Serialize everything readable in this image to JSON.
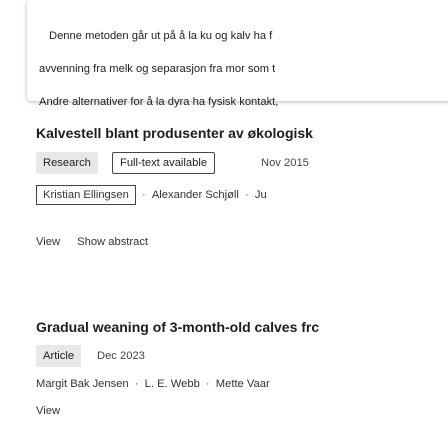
{
  "snippet": {
    "lines": [
      "Denne metoden går ut på å la ku og kalv ha f",
      "avvenning fra melk og separasjon fra mor som t",
      "Andre alternativer for å la dyra ha fysisk kontakt,"
    ]
  },
  "result1": {
    "title": "Kalvestell blant produsenter av økologisk",
    "type_label": "Research",
    "access_label": "Full-text available",
    "date": "Nov 2015",
    "authors": [
      "Kristian Ellingsen",
      "Alexander Schjøll",
      "Ju"
    ],
    "actions": [
      "View",
      "Show abstract"
    ]
  },
  "result2": {
    "title": "Gradual weaning of 3-month-old calves frc",
    "type_label": "Article",
    "date": "Dec 2023",
    "authors": [
      "Margit Bak Jensen",
      "L. E. Webb",
      "Mette Vaar"
    ],
    "actions": [
      "View"
    ]
  }
}
